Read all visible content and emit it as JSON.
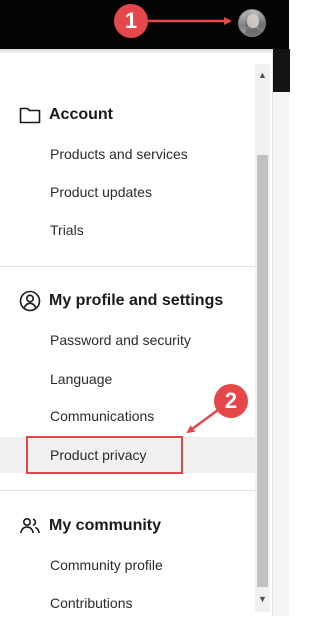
{
  "header": {
    "avatar_icon": "user-avatar"
  },
  "menu": {
    "sections": [
      {
        "title": "Account",
        "icon": "folder-icon",
        "items": [
          {
            "label": "Products and services"
          },
          {
            "label": "Product updates"
          },
          {
            "label": "Trials"
          }
        ]
      },
      {
        "title": "My profile and settings",
        "icon": "user-circle-icon",
        "items": [
          {
            "label": "Password and security"
          },
          {
            "label": "Language"
          },
          {
            "label": "Communications"
          },
          {
            "label": "Product privacy",
            "highlighted": true
          }
        ]
      },
      {
        "title": "My community",
        "icon": "people-icon",
        "items": [
          {
            "label": "Community profile"
          },
          {
            "label": "Contributions"
          }
        ]
      }
    ]
  },
  "annotations": {
    "step1": "1",
    "step2": "2",
    "color": "#e5484a"
  },
  "colors": {
    "topbar": "#050505",
    "highlight": "#f0f0f0"
  }
}
